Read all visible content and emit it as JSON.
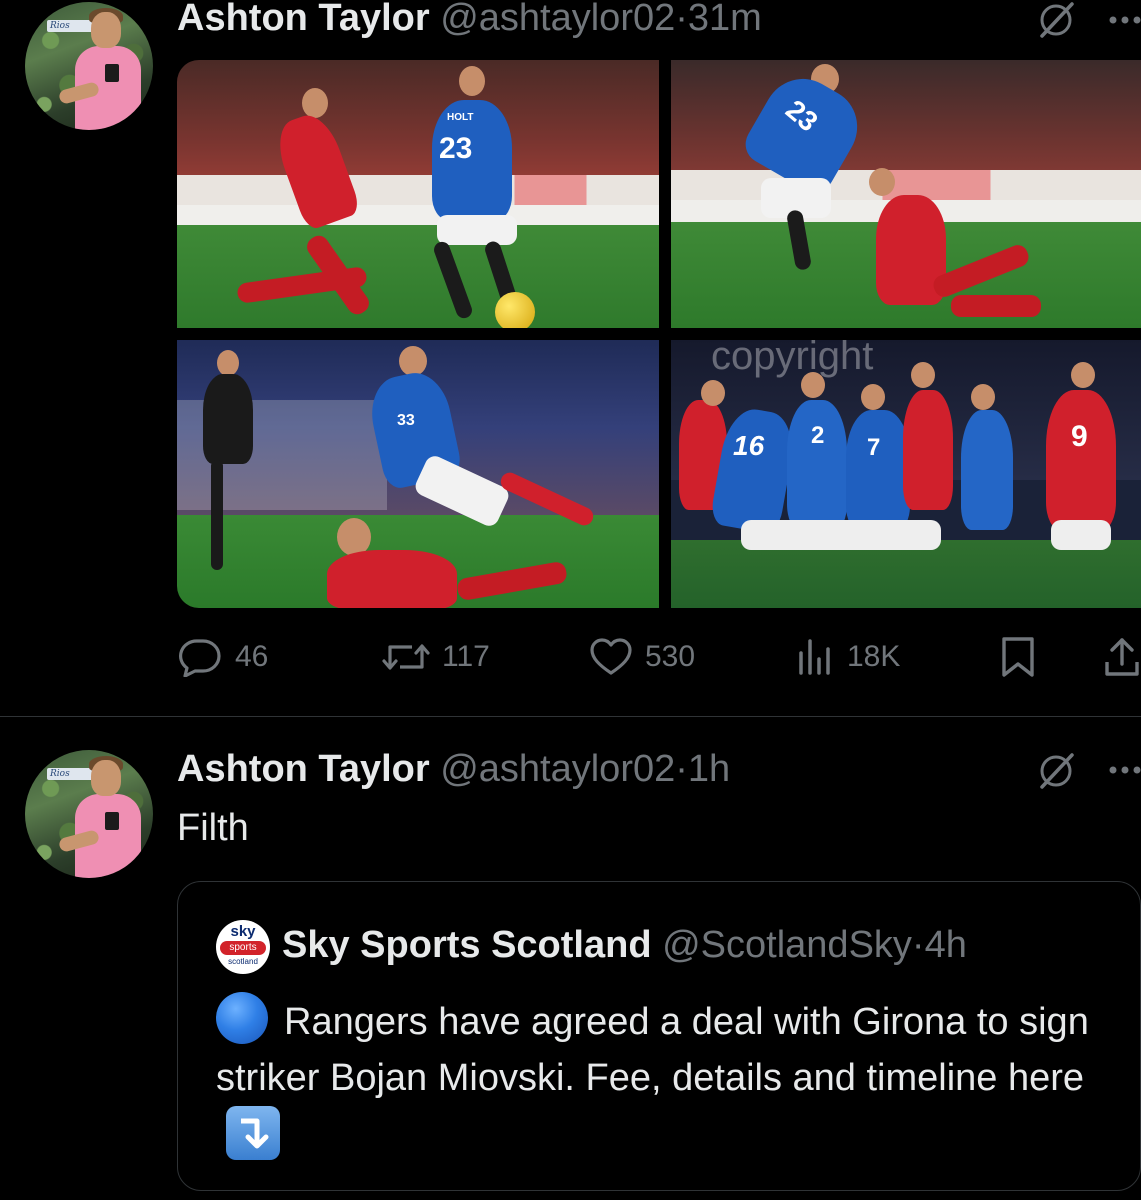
{
  "tweets": [
    {
      "author_name": "Ashton Taylor",
      "handle": "@ashtaylor02",
      "separator": "·",
      "time": "31m",
      "media": {
        "photo_1_shirt_number": "23",
        "photo_1_shirt_name": "HOLT",
        "photo_2_shirt_number": "23",
        "photo_3_shirt_number": "33",
        "photo_4_shirt_numbers": [
          "16",
          "2",
          "7",
          "9"
        ],
        "photo_4_watermark": "copyright"
      },
      "stats": {
        "replies": "46",
        "retweets": "117",
        "likes": "530",
        "views": "18K"
      }
    },
    {
      "author_name": "Ashton Taylor",
      "handle": "@ashtaylor02",
      "separator": "·",
      "time": "1h",
      "text": "Filth",
      "quote": {
        "author_name": "Sky Sports Scotland",
        "handle": "@ScotlandSky",
        "separator": "·",
        "time": "4h",
        "logo": {
          "top": "sky",
          "middle": "sports",
          "bottom": "scotland"
        },
        "text": "Rangers have agreed a deal with Girona to sign striker Bojan Miovski. Fee, details and timeline here",
        "leading_emoji": "blue-circle",
        "trailing_emoji": "arrow-down-right"
      }
    }
  ],
  "colors": {
    "background": "#000000",
    "primary_text": "#e7e9ea",
    "secondary_text": "#71767b",
    "divider": "#2f3336",
    "aberdeen_red": "#d0202c",
    "rangers_blue": "#1f5fbf"
  },
  "icons": {
    "reply": "speech-bubble-icon",
    "retweet": "retweet-icon",
    "like": "heart-icon",
    "views": "bar-chart-icon",
    "bookmark": "bookmark-icon",
    "share": "share-icon",
    "grok": "grok-icon",
    "more": "more-icon"
  }
}
